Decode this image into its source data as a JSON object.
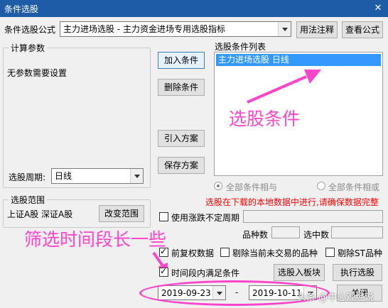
{
  "window": {
    "title": "条件选股"
  },
  "top": {
    "formula_label": "条件选股公式",
    "formula_value": "主力进场选股 - 主力资金进场专用选股指标",
    "usage_button": "用法注释",
    "view_formula_button": "查看公式"
  },
  "params": {
    "group_title": "计算参数",
    "none_text": "无参数需要设置",
    "period_label": "选股周期:",
    "period_value": "日线"
  },
  "scope": {
    "group_title": "选股范围",
    "value": "上证A股 深证A股",
    "change_button": "改变范围"
  },
  "buttons": {
    "add": "加入条件",
    "delete": "删除条件",
    "import": "引入方案",
    "save": "保存方案",
    "to_block": "选股入板块",
    "execute": "执行选股",
    "close": "关闭"
  },
  "conditions": {
    "label": "选股条件列表",
    "items": [
      "主力进场选股  日线"
    ],
    "radio_and": "全部条件相与",
    "radio_or": "全部条件相或"
  },
  "notice": "选股在下载的本地数据中进行,请确保数据完整",
  "options": {
    "irregular_period": "使用涨跌不定周期",
    "count_label": "品种数",
    "selected_label": "选中数",
    "forward_adjust": "前复权数据",
    "exclude_suspended": "剔除当前未交易的品种",
    "exclude_st": "剔除ST品种",
    "time_range": "时间段内满足条件"
  },
  "dates": {
    "start": "2019-09-23",
    "separator": "-",
    "end": "2019-10-11"
  },
  "annotations": {
    "conditions_note": "选股条件",
    "period_note": "筛选时间段长一些",
    "watermark": "头条 @中心观经说"
  },
  "colors": {
    "titlebar": "#1f5ca8",
    "selection": "#3399ff",
    "notice": "#ff0000",
    "annotation": "#ff44cc"
  }
}
